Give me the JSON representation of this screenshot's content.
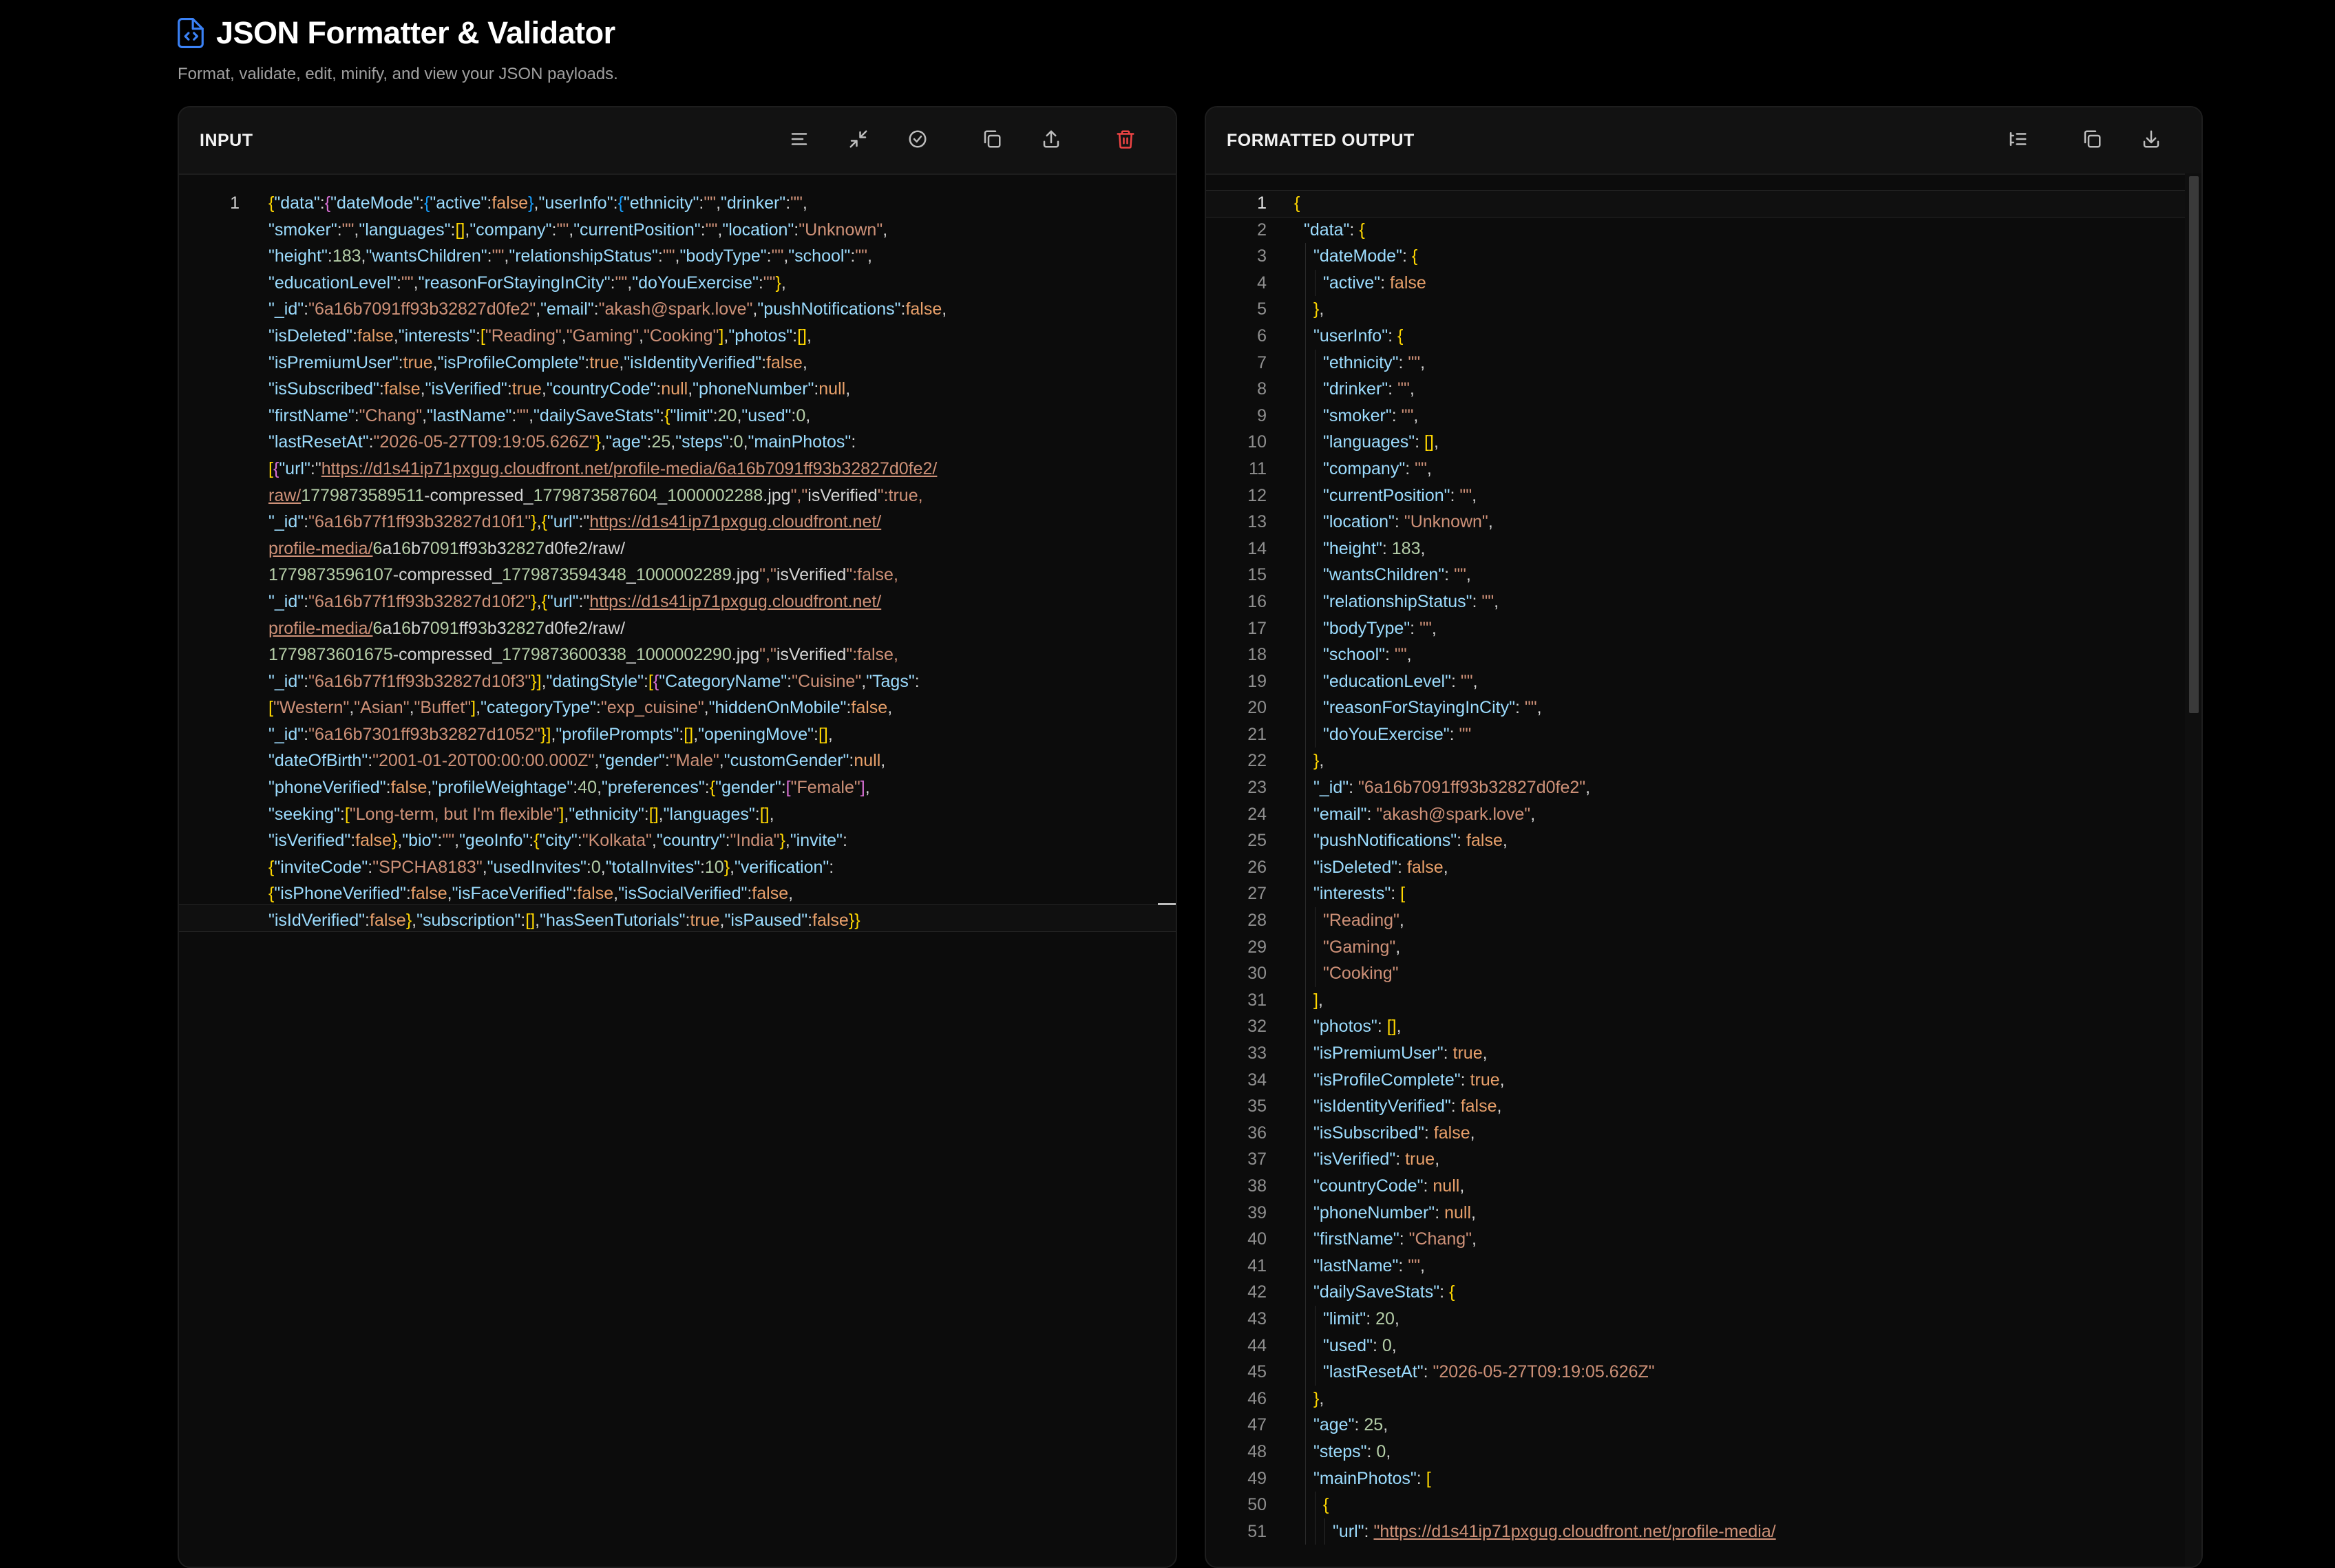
{
  "app": {
    "title": "JSON Formatter & Validator",
    "subtitle": "Format, validate, edit, minify, and view your JSON payloads.",
    "logo_icon": "file-code-icon",
    "accent": "#3b82f6"
  },
  "input_panel": {
    "title": "INPUT",
    "tools": [
      {
        "name": "format-icon"
      },
      {
        "name": "minify-icon"
      },
      {
        "name": "validate-icon"
      },
      {
        "name": "copy-icon"
      },
      {
        "name": "upload-icon"
      },
      {
        "name": "delete-icon",
        "color": "#ef4444"
      }
    ],
    "line_number": "1"
  },
  "output_panel": {
    "title": "FORMATTED OUTPUT",
    "tools": [
      {
        "name": "tree-view-icon"
      },
      {
        "name": "copy-icon"
      },
      {
        "name": "download-icon"
      }
    ],
    "lines": [
      "{",
      "\"data\": {",
      "\"dateMode\": {",
      "\"active\": false",
      "},",
      "\"userInfo\": {",
      "\"ethnicity\": \"\",",
      "\"drinker\": \"\",",
      "\"smoker\": \"\",",
      "\"languages\": [],",
      "\"company\": \"\",",
      "\"currentPosition\": \"\",",
      "\"location\": \"Unknown\",",
      "\"height\": 183,",
      "\"wantsChildren\": \"\",",
      "\"relationshipStatus\": \"\",",
      "\"bodyType\": \"\",",
      "\"school\": \"\",",
      "\"educationLevel\": \"\",",
      "\"reasonForStayingInCity\": \"\",",
      "\"doYouExercise\": \"\"",
      "},",
      "\"_id\": \"6a16b7091ff93b32827d0fe2\",",
      "\"email\": \"akash@spark.love\",",
      "\"pushNotifications\": false,",
      "\"isDeleted\": false,",
      "\"interests\": [",
      "\"Reading\",",
      "\"Gaming\",",
      "\"Cooking\"",
      "],",
      "\"photos\": [],",
      "\"isPremiumUser\": true,",
      "\"isProfileComplete\": true,",
      "\"isIdentityVerified\": false,",
      "\"isSubscribed\": false,",
      "\"isVerified\": true,",
      "\"countryCode\": null,",
      "\"phoneNumber\": null,",
      "\"firstName\": \"Chang\",",
      "\"lastName\": \"\",",
      "\"dailySaveStats\": {",
      "\"limit\": 20,",
      "\"used\": 0,",
      "\"lastResetAt\": \"2026-05-27T09:19:05.626Z\"",
      "},",
      "\"age\": 25,",
      "\"steps\": 0,",
      "\"mainPhotos\": [",
      "{",
      "\"url\": \"https://d1s41ip71pxgug.cloudfront.net/profile-media/"
    ],
    "indents": [
      0,
      1,
      2,
      3,
      2,
      2,
      3,
      3,
      3,
      3,
      3,
      3,
      3,
      3,
      3,
      3,
      3,
      3,
      3,
      3,
      3,
      2,
      2,
      2,
      2,
      2,
      2,
      3,
      3,
      3,
      2,
      2,
      2,
      2,
      2,
      2,
      2,
      2,
      2,
      2,
      2,
      2,
      3,
      3,
      3,
      2,
      2,
      2,
      2,
      3,
      4
    ]
  },
  "input_text_lines": [
    "{\"data\":{\"dateMode\":{\"active\":false},\"userInfo\":{\"ethnicity\":\"\",\"drinker\":\"\",",
    "\"smoker\":\"\",\"languages\":[],\"company\":\"\",\"currentPosition\":\"\",\"location\":\"Unknown\",",
    "\"height\":183,\"wantsChildren\":\"\",\"relationshipStatus\":\"\",\"bodyType\":\"\",\"school\":\"\",",
    "\"educationLevel\":\"\",\"reasonForStayingInCity\":\"\",\"doYouExercise\":\"\"},",
    "\"_id\":\"6a16b7091ff93b32827d0fe2\",\"email\":\"akash@spark.love\",\"pushNotifications\":false,",
    "\"isDeleted\":false,\"interests\":[\"Reading\",\"Gaming\",\"Cooking\"],\"photos\":[],",
    "\"isPremiumUser\":true,\"isProfileComplete\":true,\"isIdentityVerified\":false,",
    "\"isSubscribed\":false,\"isVerified\":true,\"countryCode\":null,\"phoneNumber\":null,",
    "\"firstName\":\"Chang\",\"lastName\":\"\",\"dailySaveStats\":{\"limit\":20,\"used\":0,",
    "\"lastResetAt\":\"2026-05-27T09:19:05.626Z\"},\"age\":25,\"steps\":0,\"mainPhotos\":",
    "[{\"url\":\"https://d1s41ip71pxgug.cloudfront.net/profile-media/6a16b7091ff93b32827d0fe2/",
    "raw/1779873589511-compressed_1779873587604_1000002288.jpg\",\"isVerified\":true,",
    "\"_id\":\"6a16b77f1ff93b32827d10f1\"},{\"url\":\"https://d1s41ip71pxgug.cloudfront.net/",
    "profile-media/6a16b7091ff93b32827d0fe2/raw/",
    "1779873596107-compressed_1779873594348_1000002289.jpg\",\"isVerified\":false,",
    "\"_id\":\"6a16b77f1ff93b32827d10f2\"},{\"url\":\"https://d1s41ip71pxgug.cloudfront.net/",
    "profile-media/6a16b7091ff93b32827d0fe2/raw/",
    "1779873601675-compressed_1779873600338_1000002290.jpg\",\"isVerified\":false,",
    "\"_id\":\"6a16b77f1ff93b32827d10f3\"}],\"datingStyle\":[{\"CategoryName\":\"Cuisine\",\"Tags\":",
    "[\"Western\",\"Asian\",\"Buffet\"],\"categoryType\":\"exp_cuisine\",\"hiddenOnMobile\":false,",
    "\"_id\":\"6a16b7301ff93b32827d1052\"}],\"profilePrompts\":[],\"openingMove\":[],",
    "\"dateOfBirth\":\"2001-01-20T00:00:00.000Z\",\"gender\":\"Male\",\"customGender\":null,",
    "\"phoneVerified\":false,\"profileWeightage\":40,\"preferences\":{\"gender\":[\"Female\"],",
    "\"seeking\":[\"Long-term, but I'm flexible\"],\"ethnicity\":[],\"languages\":[],",
    "\"isVerified\":false},\"bio\":\"\",\"geoInfo\":{\"city\":\"Kolkata\",\"country\":\"India\"},\"invite\":",
    "{\"inviteCode\":\"SPCHA8183\",\"usedInvites\":0,\"totalInvites\":10},\"verification\":",
    "{\"isPhoneVerified\":false,\"isFaceVerified\":false,\"isSocialVerified\":false,",
    "\"isIdVerified\":false},\"subscription\":[],\"hasSeenTutorials\":true,\"isPaused\":false}}"
  ]
}
